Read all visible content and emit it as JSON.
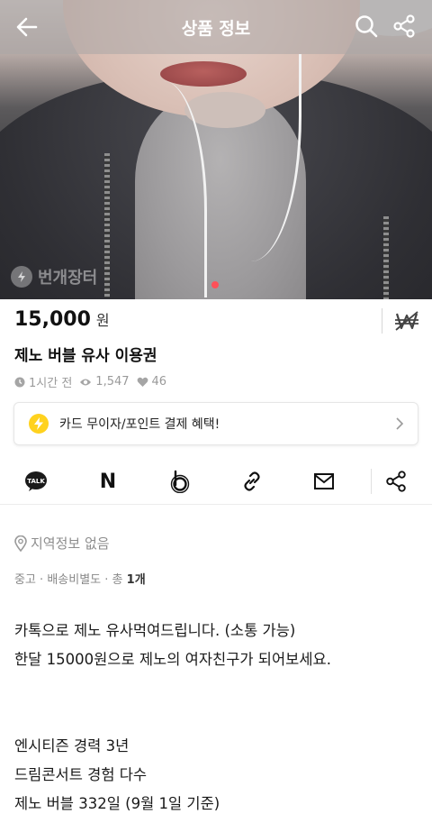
{
  "header": {
    "title": "상품 정보"
  },
  "watermark": {
    "text": "번개장터"
  },
  "product": {
    "price": "15,000",
    "currency": "원",
    "title": "제노 버블 유사 이용권",
    "time_ago": "1시간 전",
    "views": "1,547",
    "likes": "46"
  },
  "promo": {
    "text": "카드 무이자/포인트 결제 혜택!"
  },
  "share": {
    "icons": [
      "kakaotalk-icon",
      "naver-icon",
      "band-icon",
      "link-icon",
      "mail-icon",
      "share-icon"
    ],
    "talk_label": "TALK",
    "naver_label": "N"
  },
  "location": {
    "text": "지역정보 없음"
  },
  "tags": {
    "condition": "중고",
    "shipping": "배송비별도",
    "count_prefix": "총",
    "count": "1개"
  },
  "description": {
    "lines": [
      "카톡으로 제노 유사먹여드립니다. (소통 가능)",
      "한달 15000원으로 제노의 여자친구가 되어보세요.",
      "",
      "",
      "엔시티즌 경력 3년",
      "드림콘서트 경험 다수",
      "제노 버블 332일 (9월 1일 기준)"
    ]
  },
  "colors": {
    "accent": "#ff5058",
    "promo_icon": "#ffd21e"
  }
}
